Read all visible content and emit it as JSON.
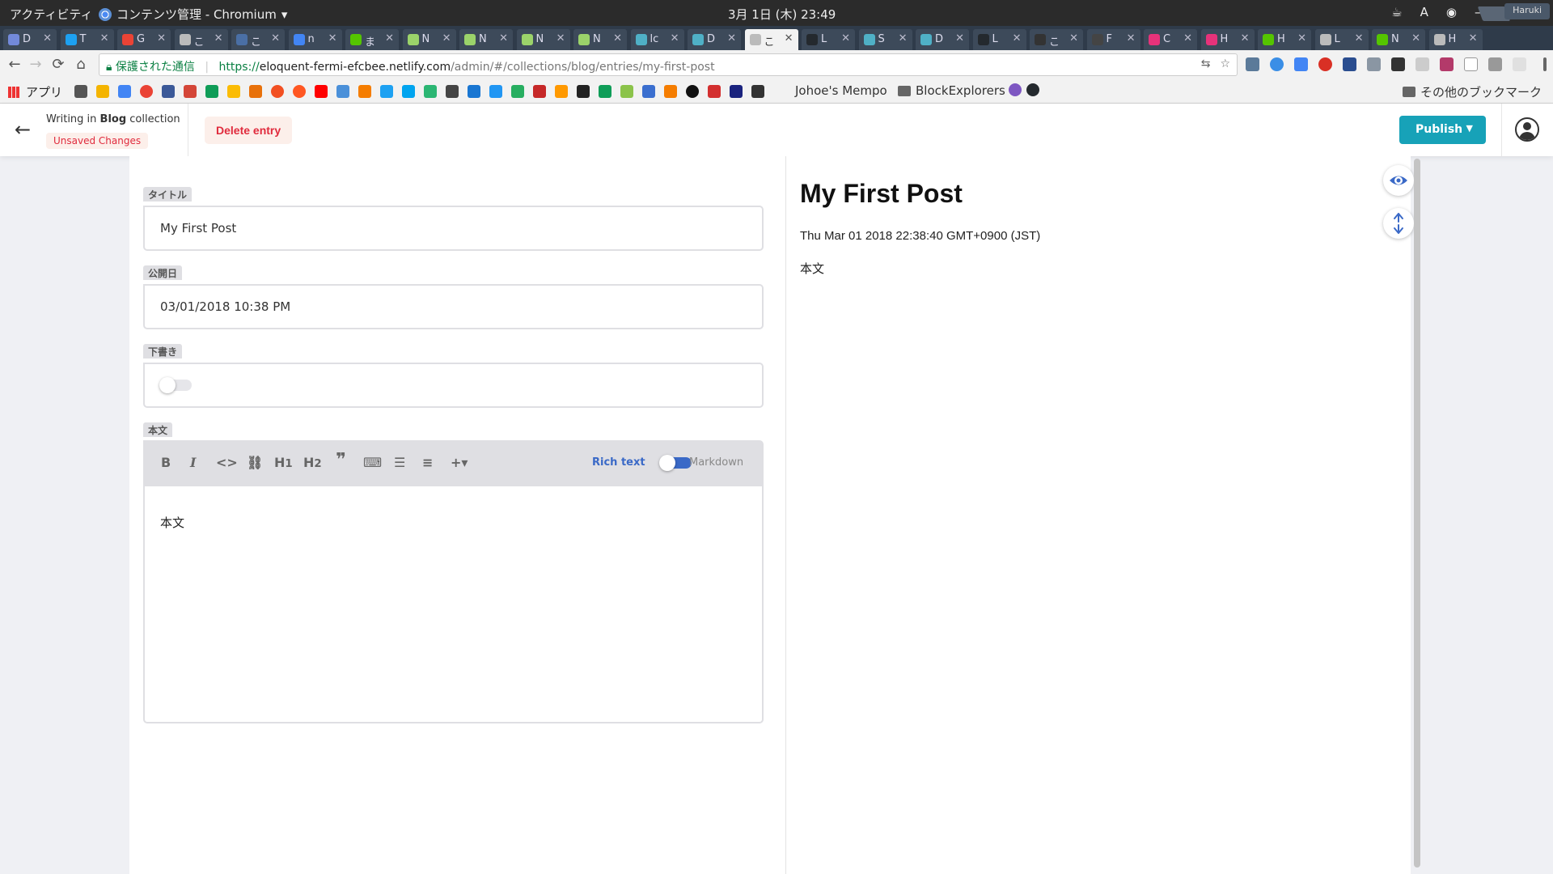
{
  "system_bar": {
    "activities": "アクティビティ",
    "app_name": "コンテンツ管理 - Chromium",
    "clock": "3月 1日 (木) 23:49",
    "input_method": "A"
  },
  "tabs": [
    {
      "label": "D",
      "color": "#7289da"
    },
    {
      "label": "T",
      "color": "#1da1f2"
    },
    {
      "label": "G",
      "color": "#ea4335"
    },
    {
      "label": "こ",
      "color": "#bbbbbb"
    },
    {
      "label": "こ",
      "color": "#4a6fa5"
    },
    {
      "label": "n",
      "color": "#4285f4"
    },
    {
      "label": "ま",
      "color": "#55c500"
    },
    {
      "label": "N",
      "color": "#9bd36a"
    },
    {
      "label": "N",
      "color": "#9bd36a"
    },
    {
      "label": "N",
      "color": "#9bd36a"
    },
    {
      "label": "N",
      "color": "#9bd36a"
    },
    {
      "label": "lc",
      "color": "#4fb0c6"
    },
    {
      "label": "D",
      "color": "#4fb0c6"
    },
    {
      "label": "こ",
      "color": "#bbbbbb",
      "active": true
    },
    {
      "label": "L",
      "color": "#24292e"
    },
    {
      "label": "S",
      "color": "#4fb0c6"
    },
    {
      "label": "D",
      "color": "#4fb0c6"
    },
    {
      "label": "L",
      "color": "#24292e"
    },
    {
      "label": "こ",
      "color": "#333333"
    },
    {
      "label": "F",
      "color": "#444444"
    },
    {
      "label": "C",
      "color": "#e6327a"
    },
    {
      "label": "H",
      "color": "#e6327a"
    },
    {
      "label": "H",
      "color": "#55c500"
    },
    {
      "label": "L",
      "color": "#bbbbbb"
    },
    {
      "label": "N",
      "color": "#55c500"
    },
    {
      "label": "H",
      "color": "#bbbbbb"
    }
  ],
  "profile_name": "Haruki",
  "omnibox": {
    "secure_label": "保護された通信",
    "scheme": "https://",
    "host": "eloquent-fermi-efcbee.netlify.com",
    "path": "/admin/#/collections/blog/entries/my-first-post"
  },
  "bookmarks": {
    "apps_label": "アプリ",
    "item_johoe": "Johoe's Mempo",
    "item_block": "BlockExplorers",
    "other": "その他のブックマーク"
  },
  "cms_header": {
    "writing_in_prefix": "Writing in ",
    "collection_name": "Blog",
    "writing_in_suffix": " collection",
    "unsaved_badge": "Unsaved Changes",
    "delete_label": "Delete entry",
    "publish_label": "Publish"
  },
  "editor": {
    "title_label": "タイトル",
    "title_value": "My First Post",
    "date_label": "公開日",
    "date_value": "03/01/2018 10:38 PM",
    "draft_label": "下書き",
    "draft_on": false,
    "body_label": "本文",
    "richtext_label": "Rich text",
    "markdown_label": "Markdown",
    "body_value": "本文"
  },
  "preview": {
    "title": "My First Post",
    "date": "Thu Mar 01 2018 22:38:40 GMT+0900 (JST)",
    "body": "本文"
  }
}
